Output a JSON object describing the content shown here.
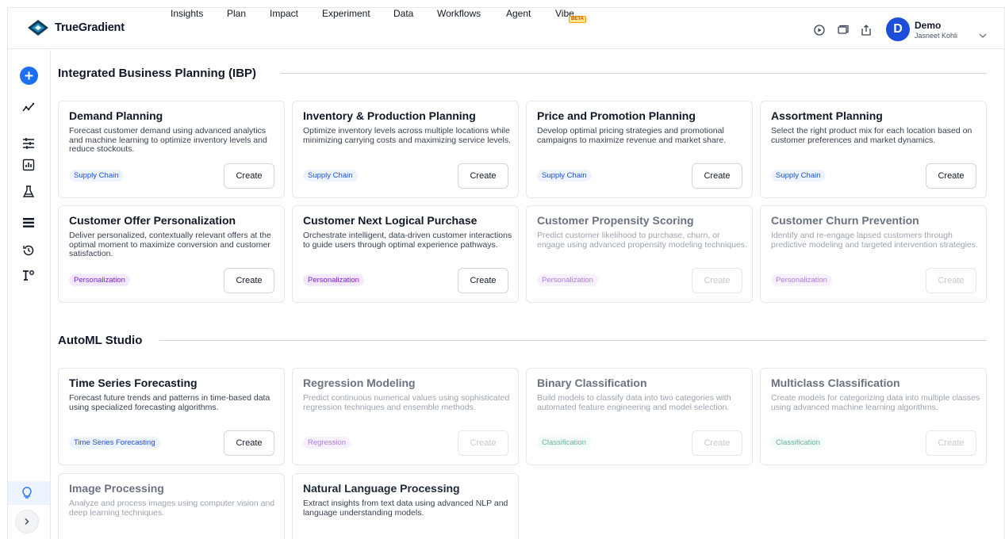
{
  "app": {
    "brand": "TrueGradient",
    "nav": [
      "Insights",
      "Plan",
      "Impact",
      "Experiment",
      "Data",
      "Workflows",
      "Agent",
      "Vibe"
    ],
    "beta_badge": "BETA",
    "user": {
      "initial": "D",
      "name": "Demo",
      "subtitle": "Jasneet Kohli"
    },
    "accent": "#1d6ff2"
  },
  "sidebar": {
    "icons": [
      "add-icon",
      "trend-icon",
      "sliders-icon",
      "chart-icon",
      "flask-icon",
      "list-icon",
      "history-icon",
      "settings-user-icon",
      "lightbulb-icon",
      "chevron-right-icon"
    ]
  },
  "sections": [
    {
      "title": "Integrated Business Planning (IBP)",
      "cards": [
        {
          "title": "Demand Planning",
          "desc": "Forecast customer demand using advanced analytics and machine learning to optimize inventory levels and reduce stockouts.",
          "tag": "Supply Chain",
          "button": "Create"
        },
        {
          "title": "Inventory & Production Planning",
          "desc": "Optimize inventory levels across multiple locations while minimizing carrying costs and maximizing service levels.",
          "tag": "Supply Chain",
          "button": "Create"
        },
        {
          "title": "Price and Promotion Planning",
          "desc": "Develop optimal pricing strategies and promotional campaigns to maximize revenue and market share.",
          "tag": "Supply Chain",
          "button": "Create"
        },
        {
          "title": "Assortment Planning",
          "desc": "Select the right product mix for each location based on customer preferences and market dynamics.",
          "tag": "Supply Chain",
          "button": "Create"
        },
        {
          "title": "Customer Offer Personalization",
          "desc": "Deliver personalized, contextually relevant offers at the optimal moment to maximize conversion and customer satisfaction.",
          "tag": "Personalization",
          "button": "Create"
        },
        {
          "title": "Customer Next Logical Purchase",
          "desc": "Orchestrate intelligent, data-driven customer interactions to guide users through optimal experience pathways.",
          "tag": "Personalization",
          "button": "Create"
        },
        {
          "title": "Customer Propensity Scoring",
          "desc": "Predict customer likelihood to purchase, churn, or engage using advanced propensity modeling techniques.",
          "tag": "Personalization",
          "button": "Create"
        },
        {
          "title": "Customer Churn Prevention",
          "desc": "Identify and re-engage lapsed customers through predictive modeling and targeted intervention strategies.",
          "tag": "Personalization",
          "button": "Create"
        }
      ]
    },
    {
      "title": "AutoML Studio",
      "cards": [
        {
          "title": "Time Series Forecasting",
          "desc": "Forecast future trends and patterns in time-based data using specialized forecasting algorithms.",
          "tag": "Time Series Forecasting",
          "button": "Create"
        },
        {
          "title": "Regression Modeling",
          "desc": "Predict continuous numerical values using sophisticated regression techniques and ensemble methods.",
          "tag": "Regression",
          "button": "Create"
        },
        {
          "title": "Binary Classification",
          "desc": "Build models to classify data into two categories with automated feature engineering and model selection.",
          "tag": "Classification",
          "button": "Create"
        },
        {
          "title": "Multiclass Classification",
          "desc": "Create models for categorizing data into multiple classes using advanced machine learning algorithms.",
          "tag": "Classification",
          "button": "Create"
        },
        {
          "title": "Image Processing",
          "desc": "Analyze and process images using computer vision and deep learning techniques."
        },
        {
          "title": "Natural Language Processing",
          "desc": "Extract insights from text data using advanced NLP and language understanding models."
        }
      ]
    }
  ]
}
